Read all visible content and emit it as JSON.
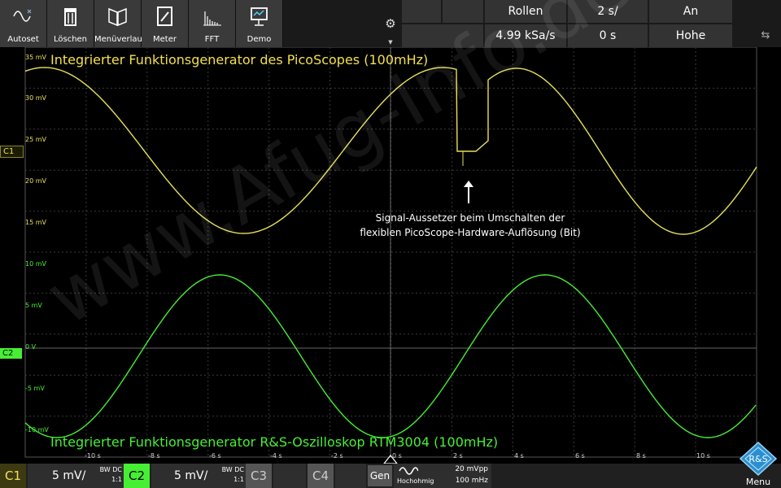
{
  "toolbar": {
    "buttons": [
      {
        "label": "Autoset",
        "icon": "autoset-icon"
      },
      {
        "label": "Löschen",
        "icon": "trash-icon"
      },
      {
        "label": "Menüverlauf",
        "icon": "menu-history-icon"
      },
      {
        "label": "Meter",
        "icon": "meter-icon"
      },
      {
        "label": "FFT",
        "icon": "fft-icon"
      },
      {
        "label": "Demo",
        "icon": "demo-icon"
      }
    ],
    "gear_icon": "gear-icon",
    "acquisition": {
      "mode": "Rollen",
      "timebase": "2 s/",
      "state": "An",
      "sample_rate": "4.99 kSa/s",
      "position": "0 s",
      "resolution": "Hohe Auflösung"
    },
    "usb_icon": "usb-icon"
  },
  "screen": {
    "ch1_marker": "C1",
    "ch2_marker": "C2",
    "ch1_ticks": [
      "35 mV",
      "30 mV",
      "25 mV",
      "20 mV",
      "15 mV"
    ],
    "ch2_ticks": [
      "10 mV",
      "5 mV",
      "0 V",
      "-5 mV",
      "-10 mV"
    ],
    "x_ticks": [
      "-10 s",
      "-8 s",
      "-6 s",
      "-4 s",
      "-2 s",
      "0 s",
      "2 s",
      "4 s",
      "6 s",
      "8 s",
      "10 s"
    ],
    "label_ch1": "Integrierter  Funktionsgenerator des PicoScopes  (100mHz)",
    "label_ch2": "Integrierter  Funktionsgenerator R&S-Oszilloskop RTM3004  (100mHz)",
    "annotation_line1": "Signal-Aussetzer beim Umschalten der",
    "annotation_line2": "flexiblen PicoScope-Hardware-Auflösung (Bit)",
    "watermark": "www.Afug-Info.de",
    "colors": {
      "ch1": "#e8e05a",
      "ch2": "#46ef33",
      "grid": "#3a3a3a"
    }
  },
  "bottombar": {
    "c1": {
      "tag": "C1",
      "scale": "5 mV/",
      "coupling_top": "BW DC",
      "probe": "1:1"
    },
    "c2": {
      "tag": "C2",
      "scale": "5 mV/",
      "coupling_top": "BW DC",
      "probe": "1:1"
    },
    "c3": {
      "tag": "C3"
    },
    "c4": {
      "tag": "C4"
    },
    "gen": {
      "tag": "Gen",
      "wave_icon": "sine-wave-icon",
      "impedance": "Hochohmig",
      "amplitude": "20 mVpp",
      "frequency": "100 mHz"
    },
    "menu": {
      "label": "Menu",
      "logo": "rs-logo-icon"
    }
  }
}
